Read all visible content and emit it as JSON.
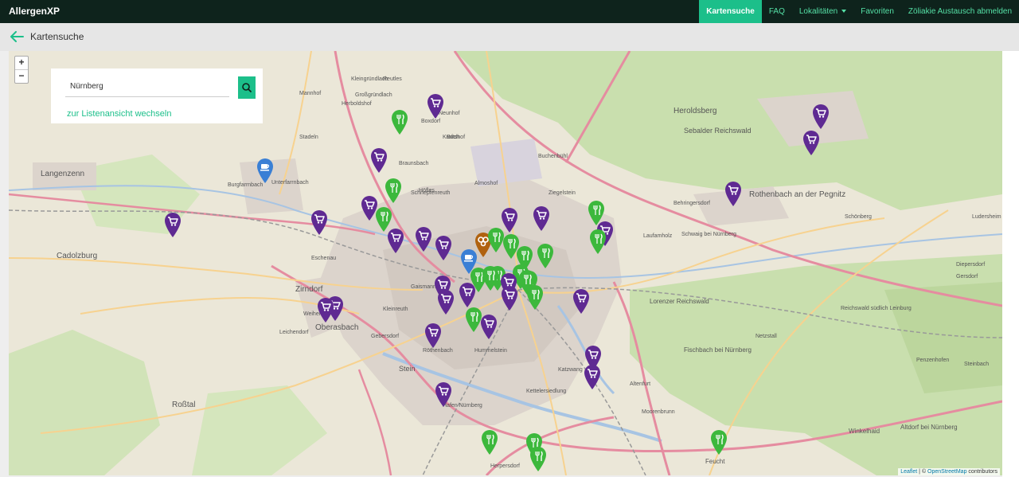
{
  "app": {
    "title": "AllergenXP"
  },
  "nav": {
    "items": [
      {
        "label": "Kartensuche",
        "active": true
      },
      {
        "label": "FAQ"
      },
      {
        "label": "Lokalitäten",
        "dropdown": true
      },
      {
        "label": "Favoriten"
      },
      {
        "label": "Zöliakie Austausch abmelden"
      }
    ]
  },
  "page": {
    "title": "Kartensuche"
  },
  "search": {
    "value": "Nürnberg",
    "list_view_link": "zur Listenansicht wechseln"
  },
  "map": {
    "zoom_in": "+",
    "zoom_out": "−",
    "attribution": {
      "leaflet": "Leaflet",
      "osm": "OpenStreetMap",
      "rest": "contributors",
      "sep": " | © "
    },
    "labels": [
      "Langenzenn",
      "Cadolzburg",
      "Zirndorf",
      "Oberasbach",
      "Stein",
      "Roßtal",
      "Heroldsberg",
      "Sebalder Reichswald",
      "Rothenbach an der Pegnitz",
      "Behringersdorf",
      "Schwaig bei Nürnberg",
      "Laufamholz",
      "Lorenzer Reichswald",
      "Fischbach bei Nürnberg",
      "Feucht",
      "Winkelhaid",
      "Altdorf bei Nürnberg",
      "Moorenbrunn",
      "Altenfurt",
      "Buch",
      "Boxdorf",
      "Neunhof",
      "Kraftshof",
      "Braunsbach",
      "Almoshof",
      "Höfles",
      "Buchenbühl",
      "Ziegelstein",
      "Kleinreuth",
      "Hummelstein",
      "Gebersdorf",
      "Röthenbach",
      "Katzwang",
      "Hafen Nürnberg",
      "Kettelersiedlung",
      "Herpersdorf",
      "Burgfarrnbach",
      "Stadeln",
      "Unterfarrnbach",
      "Leichendorf",
      "Weiherhof",
      "Eschenau",
      "Schnepfenreuth",
      "Gaismannshof",
      "Reichswald südlich Leinburg",
      "Netzstall",
      "Diepersdorf",
      "Schönberg",
      "Ludersheim",
      "Penzenhofen",
      "Steinbach",
      "Gersdorf",
      "Kleingründlach",
      "Großgründlach",
      "Reutles",
      "Herboldshof",
      "Mannhof"
    ],
    "marker_types": [
      "shop",
      "restaurant",
      "cafe",
      "bakery",
      "shop-dark"
    ],
    "markers": [
      {
        "type": "shop",
        "count": null
      },
      {
        "type": "restaurant",
        "count": null
      },
      {
        "type": "shop",
        "count": null
      },
      {
        "type": "shop",
        "count": null
      },
      {
        "type": "restaurant",
        "count": null
      },
      {
        "type": "shop",
        "count": null
      },
      {
        "type": "restaurant",
        "count": null
      },
      {
        "type": "shop",
        "count": null
      },
      {
        "type": "shop",
        "count": null
      },
      {
        "type": "cafe",
        "count": null
      },
      {
        "type": "shop",
        "count": null
      },
      {
        "type": "shop",
        "count": null
      },
      {
        "type": "shop",
        "count": null
      },
      {
        "type": "shop",
        "count": null
      },
      {
        "type": "shop",
        "count": null
      },
      {
        "type": "shop",
        "count": null
      },
      {
        "type": "bakery",
        "count": null
      },
      {
        "type": "cafe",
        "count": null
      },
      {
        "type": "restaurant",
        "count": null
      },
      {
        "type": "restaurant",
        "count": null
      },
      {
        "type": "restaurant",
        "count": null
      },
      {
        "type": "restaurant",
        "count": null
      },
      {
        "type": "restaurant",
        "count": null
      },
      {
        "type": "restaurant",
        "count": null
      },
      {
        "type": "shop",
        "count": null
      },
      {
        "type": "shop",
        "count": null
      },
      {
        "type": "restaurant",
        "count": null
      },
      {
        "type": "restaurant",
        "count": null
      },
      {
        "type": "restaurant",
        "count": null
      },
      {
        "type": "shop",
        "count": null
      },
      {
        "type": "shop",
        "count": null
      },
      {
        "type": "shop",
        "count": null
      },
      {
        "type": "shop",
        "count": null
      },
      {
        "type": "shop",
        "count": null
      },
      {
        "type": "shop",
        "count": null
      },
      {
        "type": "shop",
        "count": null
      },
      {
        "type": "shop",
        "count": null
      },
      {
        "type": "restaurant",
        "count": null
      },
      {
        "type": "restaurant",
        "count": null
      },
      {
        "type": "restaurant",
        "count": null
      },
      {
        "type": "restaurant",
        "count": null
      },
      {
        "type": "shop",
        "count": null
      },
      {
        "type": "shop",
        "count": null
      },
      {
        "type": "shop",
        "count": null
      },
      {
        "type": "shop",
        "count": null
      },
      {
        "type": "shop",
        "count": null
      },
      {
        "type": "restaurant",
        "count": null
      },
      {
        "type": "restaurant",
        "count": null
      },
      {
        "type": "restaurant",
        "count": null
      },
      {
        "type": "restaurant",
        "count": null
      },
      {
        "type": "restaurant",
        "count": null
      }
    ]
  },
  "colors": {
    "brand": "#1cbf8a",
    "topbar": "#0e231c",
    "shop": "#5f2a92",
    "restaurant": "#3cb83c",
    "cafe": "#3a7fd5",
    "bakery": "#b0620f"
  }
}
